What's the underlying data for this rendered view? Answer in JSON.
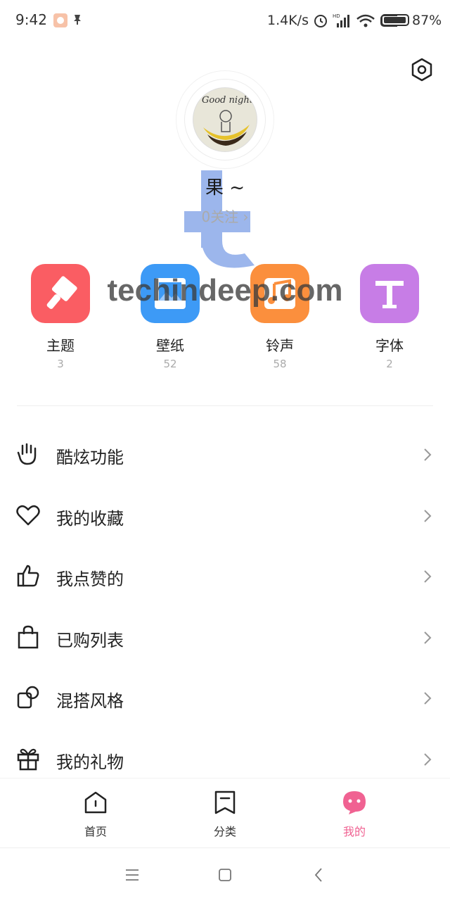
{
  "status_bar": {
    "time": "9:42",
    "net_speed": "1.4K/s",
    "battery": "87%"
  },
  "watermark": {
    "text": "techindeep.com"
  },
  "profile": {
    "avatar_text": "Good night",
    "username": "果 ~",
    "follow": "0关注 ›"
  },
  "categories": [
    {
      "label": "主题",
      "count": "3",
      "color": "#fa5d63",
      "icon": "paint-brush-icon"
    },
    {
      "label": "壁纸",
      "count": "52",
      "color": "#3d9af6",
      "icon": "picture-icon"
    },
    {
      "label": "铃声",
      "count": "58",
      "color": "#fb8f3d",
      "icon": "music-note-icon"
    },
    {
      "label": "字体",
      "count": "2",
      "color": "#c77de6",
      "icon": "font-t-icon"
    }
  ],
  "menu": [
    {
      "label": "酷炫功能",
      "icon": "hand-gesture-icon"
    },
    {
      "label": "我的收藏",
      "icon": "heart-icon"
    },
    {
      "label": "我点赞的",
      "icon": "thumbs-up-icon"
    },
    {
      "label": "已购列表",
      "icon": "shopping-bag-icon"
    },
    {
      "label": "混搭风格",
      "icon": "mix-style-icon"
    },
    {
      "label": "我的礼物",
      "icon": "gift-icon"
    }
  ],
  "bottom_nav": [
    {
      "label": "首页",
      "icon": "home-icon",
      "active": false
    },
    {
      "label": "分类",
      "icon": "category-icon",
      "active": false
    },
    {
      "label": "我的",
      "icon": "profile-face-icon",
      "active": true
    }
  ],
  "colors": {
    "accent": "#f06292",
    "text": "#222222",
    "muted": "#aaaaaa"
  }
}
